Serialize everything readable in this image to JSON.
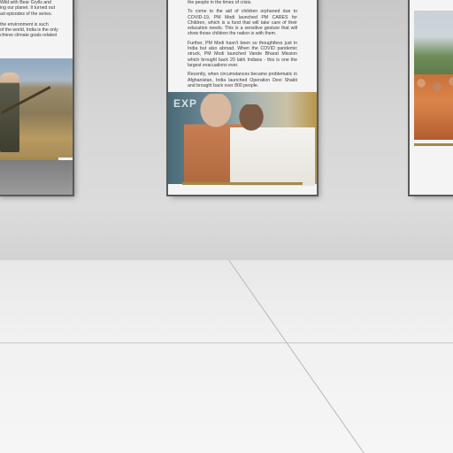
{
  "scene": {
    "posters": {
      "left": {
        "text_lines": [
          "Wild with Bear Grylls and",
          "ing our planet. It turned out",
          "ad episodes of the series.",
          "",
          "the environment is such",
          "of the world, India is the only",
          "chieve climate goals related"
        ]
      },
      "center": {
        "intro_line": "the people in the times of crisis.",
        "paragraphs": [
          "To come to the aid of children orphaned due to COVID-19, PM Modi launched PM CARES for Children, which is a fund that will take care of their education needs. This is a sensitive gesture that will show those children the nation is with them.",
          "Further, PM Modi hasn't been so thoughtless just in India but also abroad. When the COVID pandemic struck, PM Modi launched Vande Bharat Mission which brought back 20 lakh Indians - this is one the largest evacuations ever.",
          "Recently, when circumstances became problematic in Afghanistan, India launched Operation Devi Shakti and brought back over 800 people."
        ],
        "photo_banner": "EXP"
      }
    }
  }
}
